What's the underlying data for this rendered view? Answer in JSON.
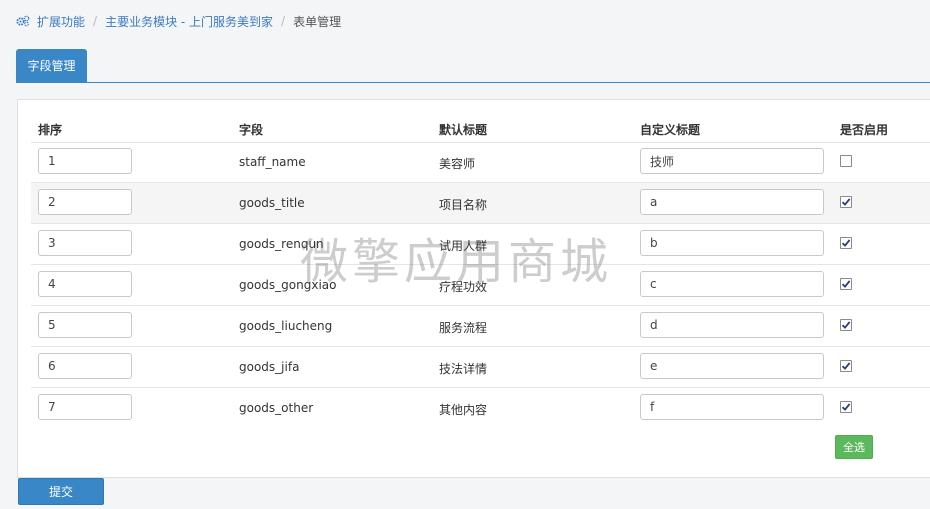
{
  "breadcrumb": {
    "items": [
      "扩展功能",
      "主要业务模块 - 上门服务美到家"
    ],
    "current": "表单管理",
    "separator": "/"
  },
  "tabs": [
    {
      "label": "字段管理",
      "active": true
    }
  ],
  "table": {
    "headers": [
      "排序",
      "字段",
      "默认标题",
      "自定义标题",
      "是否启用"
    ],
    "rows": [
      {
        "sort": "1",
        "field": "staff_name",
        "default_title": "美容师",
        "custom_title": "技师",
        "enabled": false
      },
      {
        "sort": "2",
        "field": "goods_title",
        "default_title": "项目名称",
        "custom_title": "a",
        "enabled": true
      },
      {
        "sort": "3",
        "field": "goods_renqun",
        "default_title": "试用人群",
        "custom_title": "b",
        "enabled": true
      },
      {
        "sort": "4",
        "field": "goods_gongxiao",
        "default_title": "疗程功效",
        "custom_title": "c",
        "enabled": true
      },
      {
        "sort": "5",
        "field": "goods_liucheng",
        "default_title": "服务流程",
        "custom_title": "d",
        "enabled": true
      },
      {
        "sort": "6",
        "field": "goods_jifa",
        "default_title": "技法详情",
        "custom_title": "e",
        "enabled": true
      },
      {
        "sort": "7",
        "field": "goods_other",
        "default_title": "其他内容",
        "custom_title": "f",
        "enabled": true
      }
    ]
  },
  "buttons": {
    "select_all": "全选",
    "submit": "提交"
  },
  "watermark": "微擎应用商城",
  "icons": {
    "breadcrumb": "gears-icon",
    "checkbox": "check-icon"
  },
  "colors": {
    "primary": "#3a87c8",
    "link": "#3a7ac1",
    "success": "#5cb85c"
  }
}
